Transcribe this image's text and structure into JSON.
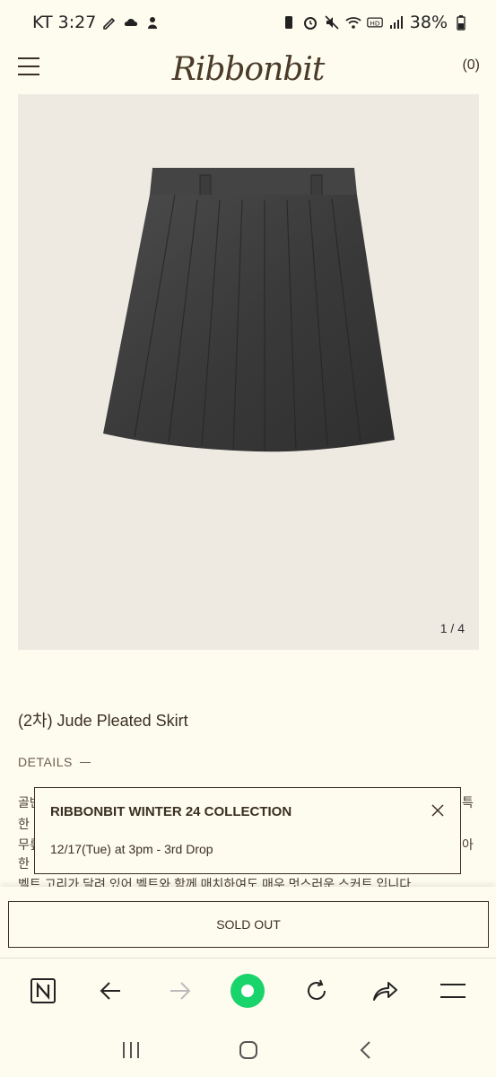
{
  "status_bar": {
    "carrier_time": "KT 3:27",
    "battery": "38%"
  },
  "header": {
    "logo": "Ribbonbit",
    "cart_count": "(0)"
  },
  "gallery": {
    "counter": "1 / 4"
  },
  "product": {
    "title": "(2차) Jude Pleated Skirt",
    "details_label": "DETAILS",
    "description_lines": [
      "골반",
      "특",
      "한",
      "무릎",
      "아",
      "한",
      "벨트 고리가 달려 있어 벨트와 함께 매치하여도 매우 멋스러운 스커트 입니다."
    ]
  },
  "popup": {
    "title": "RIBBONBIT WINTER 24 COLLECTION",
    "subtitle": "12/17(Tue) at 3pm - 3rd Drop"
  },
  "cta": {
    "label": "SOLD OUT"
  },
  "colors": {
    "background": "#fefcef",
    "text": "#3a2f22",
    "accent_green": "#19d36b"
  }
}
